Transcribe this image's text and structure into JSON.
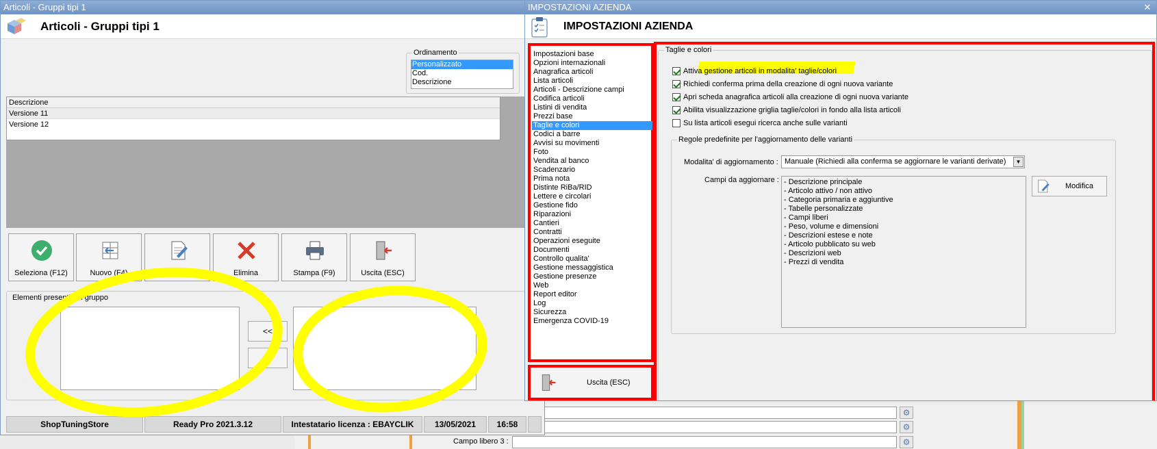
{
  "left_window": {
    "title": "Articoli - Gruppi tipi 1",
    "header_title": "Articoli - Gruppi tipi 1",
    "ordinamento": {
      "label": "Ordinamento",
      "options": [
        "Personalizzato",
        "Cod.",
        "Descrizione"
      ],
      "selected": "Personalizzato"
    },
    "grid": {
      "header": "Descrizione",
      "rows": [
        "Versione 11",
        "Versione 12"
      ]
    },
    "toolbar": {
      "seleziona": "Seleziona (F12)",
      "nuovo": "Nuovo (F4)",
      "modifica": "Modifica (F2)",
      "elimina": "Elimina",
      "stampa": "Stampa (F9)",
      "uscita": "Uscita (ESC)"
    },
    "elementi": {
      "label": "Elementi presenti nel gruppo",
      "move_left": "<<",
      "move_right": ">>"
    },
    "statusbar": {
      "store": "ShopTuningStore",
      "version": "Ready Pro 2021.3.12",
      "license": "Intestatario licenza : EBAYCLIK SRL",
      "date": "13/05/2021",
      "time": "16:58"
    }
  },
  "background": {
    "campo_libero_3": "Campo libero 3 :"
  },
  "right_window": {
    "title": "IMPOSTAZIONI AZIENDA",
    "header_title": "IMPOSTAZIONI AZIENDA",
    "close": "✕",
    "nav_items": [
      "Impostazioni base",
      "Opzioni internazionali",
      "Anagrafica articoli",
      "Lista articoli",
      "Articoli - Descrizione campi",
      "Codifica articoli",
      "Listini di vendita",
      "Prezzi base",
      "Taglie e colori",
      "Codici a barre",
      "Avvisi su movimenti",
      "Foto",
      "Vendita al banco",
      "Scadenzario",
      "Prima nota",
      "Distinte RiBa/RID",
      "Lettere e circolari",
      "Gestione fido",
      "Riparazioni",
      "Cantieri",
      "Contratti",
      "Operazioni eseguite",
      "Documenti",
      "Controllo qualita'",
      "Gestione messaggistica",
      "Gestione presenze",
      "Web",
      "Report editor",
      "Log",
      "Sicurezza",
      "Emergenza COVID-19"
    ],
    "nav_selected": "Taglie e colori",
    "uscita": "Uscita (ESC)",
    "section_title": "Taglie e colori",
    "checkboxes": [
      {
        "label": "Attiva gestione articoli in modalita' taglie/colori",
        "checked": true
      },
      {
        "label": "Richiedi conferma prima della creazione di ogni nuova variante",
        "checked": true
      },
      {
        "label": "Apri scheda anagrafica articoli alla creazione di ogni nuova variante",
        "checked": true
      },
      {
        "label": "Abilita visualizzazione griglia taglie/colori in fondo alla lista articoli",
        "checked": true
      },
      {
        "label": "Su lista articoli esegui ricerca anche sulle varianti",
        "checked": false
      }
    ],
    "regole": {
      "title": "Regole predefinite per l'aggiornamento delle varianti",
      "modalita_label": "Modalita' di aggiornamento :",
      "modalita_value": "Manuale (Richiedi alla conferma se aggiornare le varianti derivate)",
      "campi_label": "Campi da aggiornare :",
      "campi": [
        "- Descrizione principale",
        "- Articolo attivo / non attivo",
        "- Categoria primaria e aggiuntive",
        "- Tabelle personalizzate",
        "- Campi liberi",
        "- Peso, volume e dimensioni",
        "- Descrizioni estese e note",
        "- Articolo pubblicato su web",
        "- Descrizioni web",
        "- Prezzi di vendita"
      ],
      "modifica": "Modifica"
    }
  },
  "colors": {
    "highlight": "#ffff00",
    "selection": "#3399ff",
    "annotation_red": "#ff0000",
    "titlebar": "#7a9cc9"
  }
}
